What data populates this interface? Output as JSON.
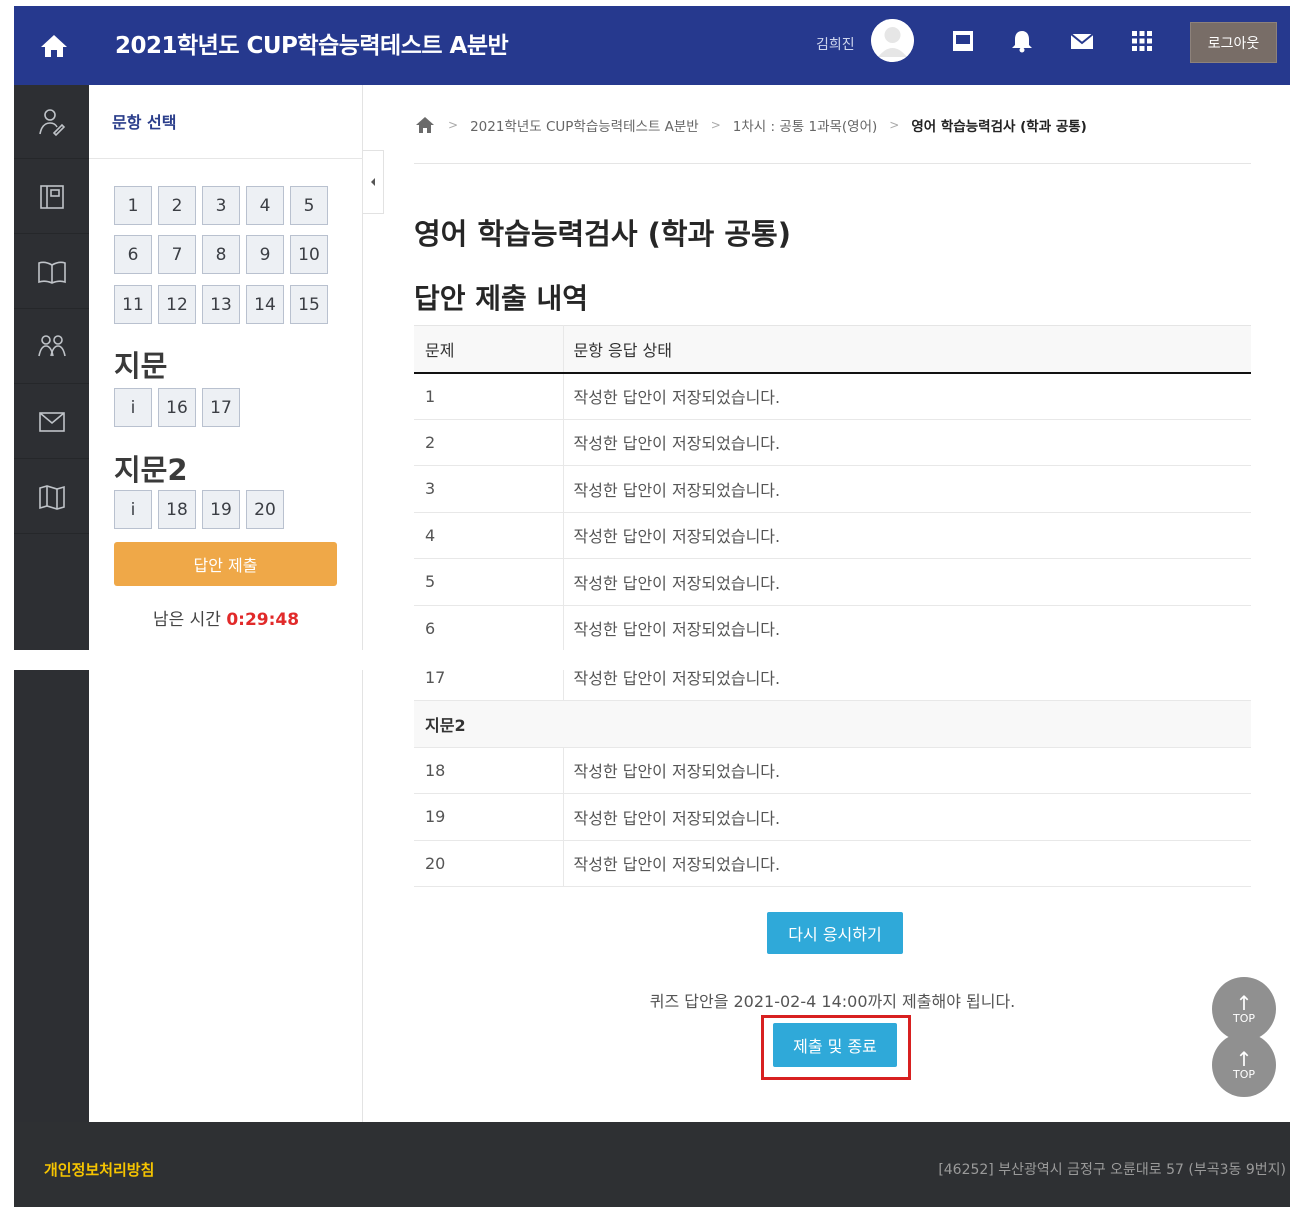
{
  "header": {
    "title": "2021학년도 CUP학습능력테스트 A분반",
    "user_name": "김희진",
    "logout_label": "로그아웃",
    "color": "#26398e"
  },
  "rail_icons": [
    "person-icon",
    "notebook-icon",
    "open-book-icon",
    "group-icon",
    "mail-icon",
    "map-icon"
  ],
  "question_panel": {
    "title": "문항 선택",
    "rows": [
      [
        "1",
        "2",
        "3",
        "4",
        "5"
      ],
      [
        "6",
        "7",
        "8",
        "9",
        "10"
      ],
      [
        "11",
        "12",
        "13",
        "14",
        "15"
      ]
    ],
    "sections": [
      {
        "label": "지문",
        "buttons": [
          "i",
          "16",
          "17"
        ]
      },
      {
        "label": "지문2",
        "buttons": [
          "i",
          "18",
          "19",
          "20"
        ]
      }
    ],
    "submit_label": "답안 제출",
    "time_label": "남은 시간 ",
    "time_value": "0:29:48"
  },
  "breadcrumb": {
    "items": [
      "2021학년도 CUP학습능력테스트 A분반",
      "1차시 : 공통 1과목(영어)"
    ],
    "current": "영어 학습능력검사 (학과 공통)"
  },
  "page_title": "영어 학습능력검사 (학과 공통)",
  "sub_title": "답안 제출 내역",
  "table": {
    "col_question": "문제",
    "col_status": "문항 응답 상태",
    "rows_top": [
      {
        "q": "1",
        "status": "작성한 답안이 저장되었습니다."
      },
      {
        "q": "2",
        "status": "작성한 답안이 저장되었습니다."
      },
      {
        "q": "3",
        "status": "작성한 답안이 저장되었습니다."
      },
      {
        "q": "4",
        "status": "작성한 답안이 저장되었습니다."
      },
      {
        "q": "5",
        "status": "작성한 답안이 저장되었습니다."
      },
      {
        "q": "6",
        "status": "작성한 답안이 저장되었습니다."
      }
    ],
    "partial_row": {
      "q": "17",
      "status": "작성한 답안이 저장되었습니다."
    },
    "group_label": "지문2",
    "rows_bottom": [
      {
        "q": "18",
        "status": "작성한 답안이 저장되었습니다."
      },
      {
        "q": "19",
        "status": "작성한 답안이 저장되었습니다."
      },
      {
        "q": "20",
        "status": "작성한 답안이 저장되었습니다."
      }
    ]
  },
  "actions": {
    "retake_label": "다시 응시하기",
    "deadline_text": "퀴즈 답안을 2021-02-4 14:00까지 제출해야 됩니다.",
    "finish_label": "제출 및 종료"
  },
  "top_button_label": "TOP",
  "footer": {
    "privacy_link": "개인정보처리방침",
    "address": "[46252] 부산광역시 금정구 오륜대로 57 (부곡3동 9번지)"
  }
}
